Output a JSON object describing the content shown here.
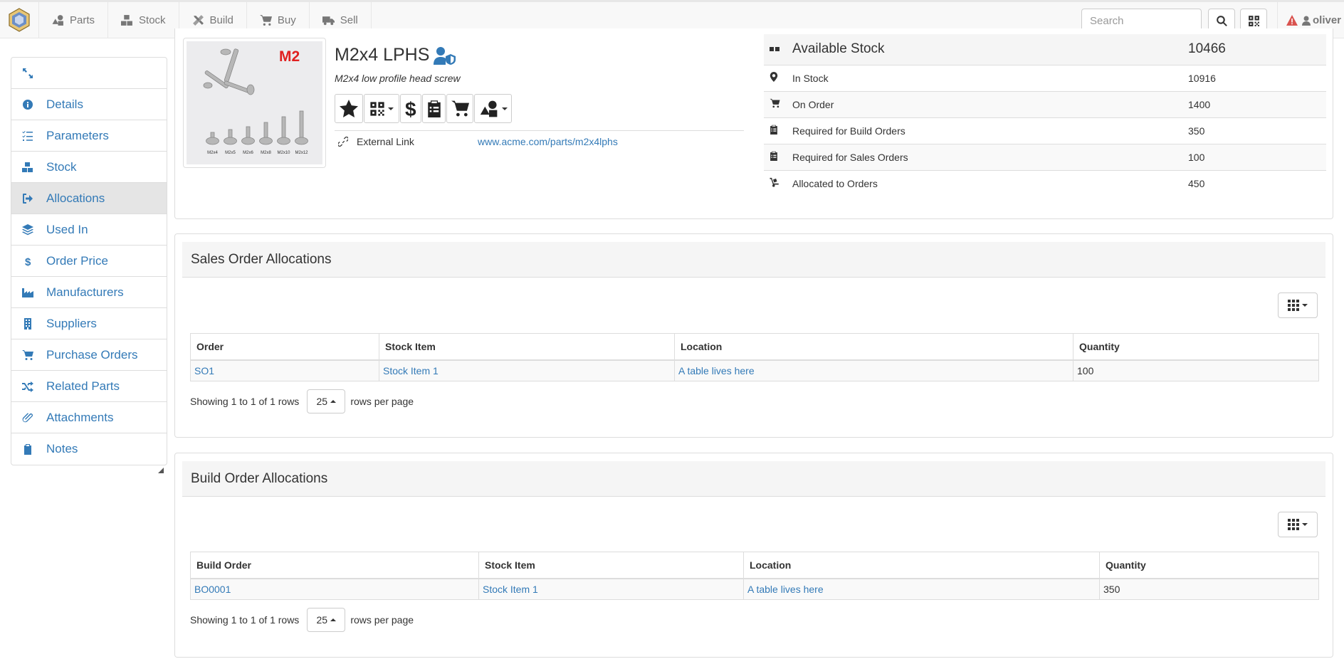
{
  "nav": {
    "items": [
      {
        "label": "Parts",
        "icon": "shapes-icon"
      },
      {
        "label": "Stock",
        "icon": "boxes-icon"
      },
      {
        "label": "Build",
        "icon": "tools-icon"
      },
      {
        "label": "Buy",
        "icon": "cart-icon"
      },
      {
        "label": "Sell",
        "icon": "truck-icon"
      }
    ],
    "search_placeholder": "Search",
    "username": "oliver"
  },
  "sidebar": {
    "items": [
      {
        "label": "Details",
        "icon": "info-circle-icon"
      },
      {
        "label": "Parameters",
        "icon": "list-icon"
      },
      {
        "label": "Stock",
        "icon": "boxes-icon"
      },
      {
        "label": "Allocations",
        "icon": "sign-out-icon",
        "active": true
      },
      {
        "label": "Used In",
        "icon": "layer-group-icon"
      },
      {
        "label": "Order Price",
        "icon": "dollar-icon"
      },
      {
        "label": "Manufacturers",
        "icon": "industry-icon"
      },
      {
        "label": "Suppliers",
        "icon": "building-icon"
      },
      {
        "label": "Purchase Orders",
        "icon": "cart-icon"
      },
      {
        "label": "Related Parts",
        "icon": "random-icon"
      },
      {
        "label": "Attachments",
        "icon": "paperclip-icon"
      },
      {
        "label": "Notes",
        "icon": "clipboard-icon"
      }
    ]
  },
  "part": {
    "image_label": "M2",
    "image_sizes": [
      "M2x4",
      "M2x5",
      "M2x6",
      "M2x8",
      "M2x10",
      "M2x12"
    ],
    "name": "M2x4 LPHS",
    "description": "M2x4 low profile head screw",
    "external_link_label": "External Link",
    "external_link": "www.acme.com/parts/m2x4lphs"
  },
  "stock": {
    "available_label": "Available Stock",
    "available_value": "10466",
    "rows": [
      {
        "label": "In Stock",
        "value": "10916",
        "icon": "map-marker-icon"
      },
      {
        "label": "On Order",
        "value": "1400",
        "icon": "cart-icon"
      },
      {
        "label": "Required for Build Orders",
        "value": "350",
        "icon": "clipboard-icon"
      },
      {
        "label": "Required for Sales Orders",
        "value": "100",
        "icon": "clipboard-icon"
      },
      {
        "label": "Allocated to Orders",
        "value": "450",
        "icon": "dolly-icon"
      }
    ]
  },
  "sales": {
    "title": "Sales Order Allocations",
    "columns": [
      "Order",
      "Stock Item",
      "Location",
      "Quantity"
    ],
    "rows": [
      {
        "order": "SO1",
        "stock_item": "Stock Item 1",
        "location": "A table lives here",
        "quantity": "100"
      }
    ],
    "showing": "Showing 1 to 1 of 1 rows",
    "page_size": "25",
    "rows_per_page": "rows per page"
  },
  "build": {
    "title": "Build Order Allocations",
    "columns": [
      "Build Order",
      "Stock Item",
      "Location",
      "Quantity"
    ],
    "rows": [
      {
        "order": "BO0001",
        "stock_item": "Stock Item 1",
        "location": "A table lives here",
        "quantity": "350"
      }
    ],
    "showing": "Showing 1 to 1 of 1 rows",
    "page_size": "25",
    "rows_per_page": "rows per page"
  }
}
